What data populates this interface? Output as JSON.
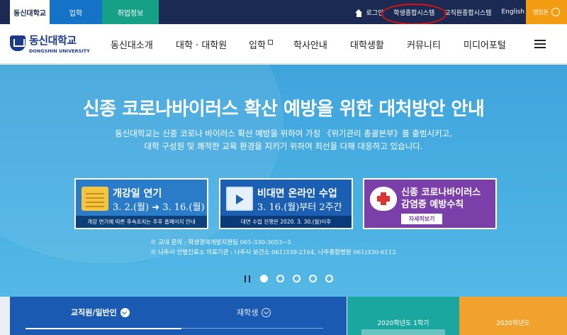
{
  "topbar": {
    "tabs": [
      {
        "label": "동신대학교",
        "active": true
      },
      {
        "label": "입학",
        "active": false
      },
      {
        "label": "취업정보",
        "active": false
      }
    ],
    "utils": {
      "login": "로그인",
      "academic_system": "학생종합시스템",
      "staff_system": "교직원종합시스템",
      "english": "English"
    },
    "app_label": "앱업존"
  },
  "header": {
    "logo_kr": "동신대학교",
    "logo_en": "DONGSHIN UNIVERSITY",
    "nav": [
      "동신대소개",
      "대학 · 대학원",
      "입학",
      "학사안내",
      "대학생활",
      "커뮤니티",
      "미디어포털"
    ]
  },
  "hero": {
    "title": "신종 코로나바이러스 확산 예방을 위한 대처방안 안내",
    "desc_line1": "동신대학교는 신종 코로나 바이러스 확산 예방을 위하여 가칭 《위기관리 총괄본부》를 출범시키고,",
    "desc_line2": "대학 구성원 및 쾌적한 교육 환경을 지키기 위하여 최선을 다해 대응하고 있습니다.",
    "cards": [
      {
        "title": "개강일 연기",
        "sub": "3. 2.(월) ➜ 3. 16.(월)",
        "foot": "개강 연기에 따른 후속조치는 추후 홈페이지 안내"
      },
      {
        "title": "비대면 온라인 수업",
        "sub": "3. 16.(월)부터 2주간",
        "foot": "대면 수업 진행은 2020. 3. 30.(월)이후"
      },
      {
        "title": "신종 코로나바이러스",
        "sub": "감염증 예방수칙",
        "button": "자세히보기"
      }
    ],
    "note1": "※ 교내 문의 : 학생경력개발지원팀 061-330-3053~5",
    "note2": "※ 나주시 선별진료소 의료기관 : 나주시 보건소 061)339-2164, 나주종합병원  061)330-6112"
  },
  "bottom": {
    "tab1": "교직원/일반인",
    "tab2": "재학생",
    "sem1": "2020학년도 1학기",
    "sem2": "2020학년도"
  }
}
